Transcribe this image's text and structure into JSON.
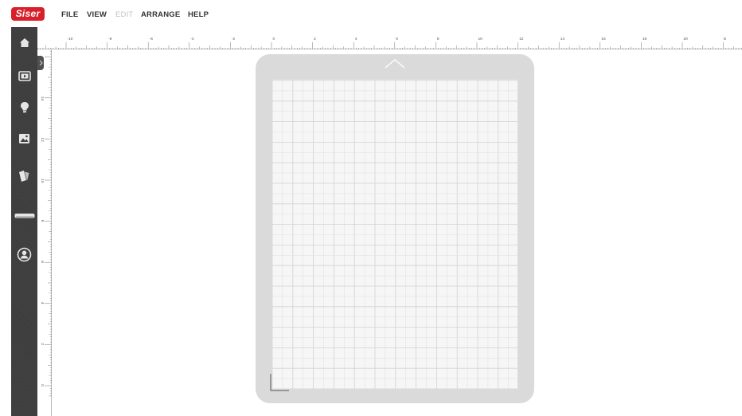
{
  "app": {
    "logo_text": "Siser",
    "brand_color": "#d8202a"
  },
  "menu": {
    "file": "FILE",
    "view": "VIEW",
    "edit": "EDIT",
    "arrange": "ARRANGE",
    "help": "HELP"
  },
  "sidebar": {
    "items": [
      {
        "name": "home",
        "icon": "home-icon"
      },
      {
        "name": "video",
        "icon": "play-icon"
      },
      {
        "name": "ideas",
        "icon": "lightbulb-icon"
      },
      {
        "name": "images",
        "icon": "image-icon"
      },
      {
        "name": "materials",
        "icon": "swatch-icon"
      },
      {
        "name": "cutter",
        "icon": "cutter-icon"
      },
      {
        "name": "account",
        "icon": "user-icon"
      }
    ],
    "expand_icon": "chevron-right-icon"
  },
  "ruler": {
    "top_labels": [
      "-10",
      "-8",
      "-6",
      "-4",
      "-2",
      "0",
      "2",
      "4",
      "6",
      "8",
      "10",
      "12",
      "14",
      "16",
      "18",
      "20",
      "in"
    ],
    "left_labels": [
      "14",
      "12",
      "10",
      "8",
      "6",
      "4",
      "2",
      "0"
    ]
  },
  "mat": {
    "up_icon": "chevron-up-icon",
    "color": "#dadada",
    "grid_color": "#f6f6f6"
  }
}
